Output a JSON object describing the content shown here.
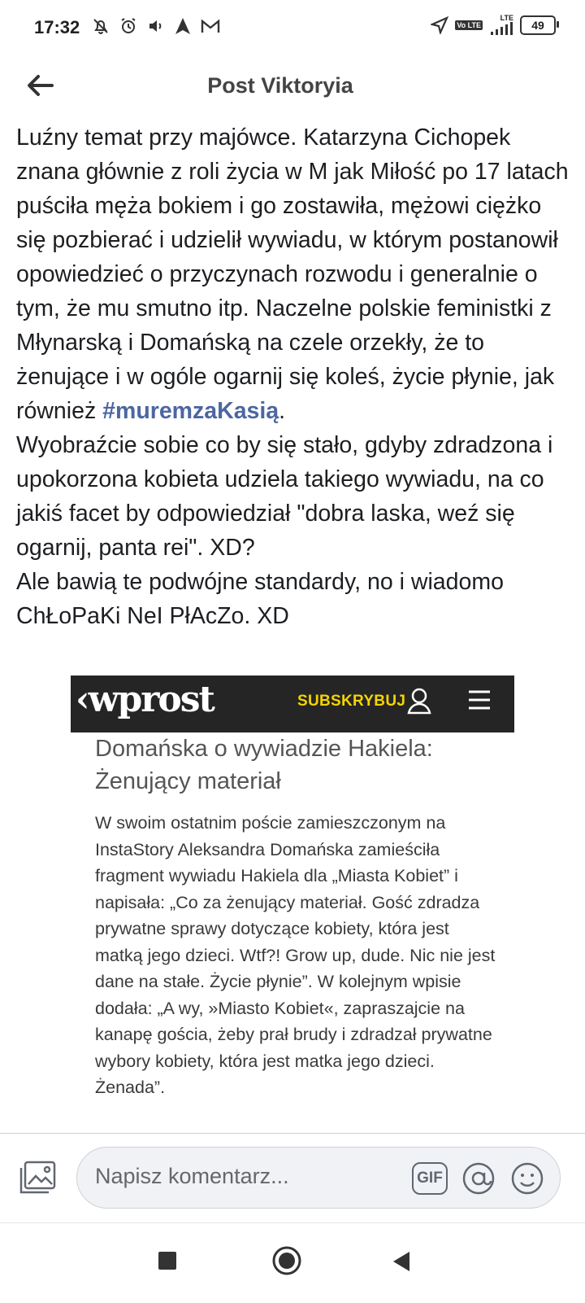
{
  "status_bar": {
    "time": "17:32",
    "battery": "49",
    "network": "LTE",
    "volte": "Vo LTE"
  },
  "header": {
    "title": "Post Viktoryia",
    "back_icon": "back-arrow-icon"
  },
  "post": {
    "text_before": "Luźny temat przy majówce. Katarzyna Cichopek znana głównie z roli życia w M jak Miłość po 17 latach puściła męża bokiem i go zostawiła, mężowi ciężko się pozbierać i udzielił wywiadu, w którym postanowił opowiedzieć o przyczynach rozwodu i generalnie o tym, że mu smutno itp. Naczelne polskie feministki z Młynarską i Domańską na czele orzekły, że to żenujące i w ogóle ogarnij się koleś, życie płynie, jak również ",
    "hashtag": "#muremzaKasią",
    "text_after": ".\nWyobraźcie sobie co by się stało, gdyby zdradzona i upokorzona kobieta udziela takiego wywiadu, na co jakiś facet by odpowiedział \"dobra laska, weź się ogarnij, panta rei\". XD?\nAle bawią te podwójne standardy, no i wiadomo ChŁoPaKi NeI PłAcZo. XD"
  },
  "article": {
    "logo": "wprost",
    "subscribe": "SUBSKRYBUJ",
    "title": "Domańska o wywiadzie Hakiela: Żenujący materiał",
    "body": "W swoim ostatnim poście zamieszczonym na InstaStory Aleksandra Domańska zamieściła fragment wywiadu Hakiela dla „Miasta Kobiet” i napisała: „Co za żenujący materiał. Gość zdradza prywatne sprawy dotyczące kobiety, która jest matką jego dzieci. Wtf?! Grow up, dude. Nic nie jest dane na stałe. Życie płynie”. W kolejnym wpisie dodała: „A wy, »Miasto Kobiet«, zapraszajcie na kanapę gościa, żeby prał brudy i zdradzał prywatne wybory kobiety, która jest matka jego dzieci. Żenada”.",
    "brand_color": "#f5d400"
  },
  "comment_bar": {
    "placeholder": "Napisz komentarz...",
    "gif_label": "GIF"
  },
  "colors": {
    "hashtag": "#4c67a1",
    "text": "#1c1e21"
  }
}
